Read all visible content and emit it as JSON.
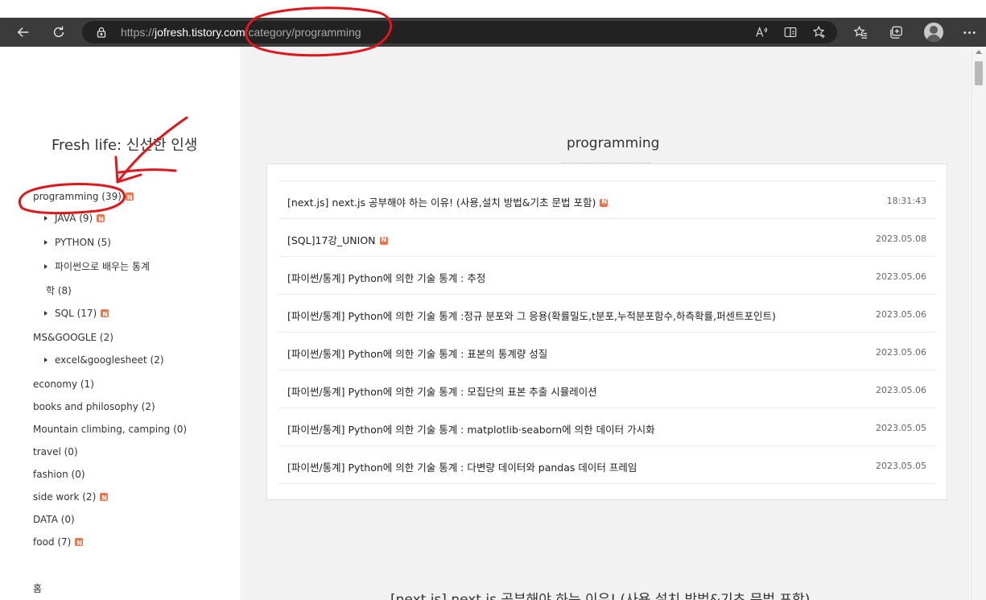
{
  "browser": {
    "url_scheme": "https://",
    "url_host": "jofresh.tistory.com",
    "url_path": "/category/programming"
  },
  "sidebar": {
    "blog_title": "Fresh life: 신선한 인생",
    "categories": [
      {
        "label": "programming (39)",
        "new": true
      },
      {
        "label": "JAVA (9)",
        "new": true
      },
      {
        "label": "PYTHON (5)",
        "new": false
      },
      {
        "label": "파이썬으로 배우는 통계",
        "new": false
      },
      {
        "label": "학 (8)",
        "new": false
      },
      {
        "label": "SQL (17)",
        "new": true
      },
      {
        "label": "MS&GOOGLE (2)",
        "new": false
      },
      {
        "label": "excel&googlesheet (2)",
        "new": false
      },
      {
        "label": "economy (1)",
        "new": false
      },
      {
        "label": "books and philosophy (2)",
        "new": false
      },
      {
        "label": "Mountain climbing, camping (0)",
        "new": false
      },
      {
        "label": "travel (0)",
        "new": false
      },
      {
        "label": "fashion (0)",
        "new": false
      },
      {
        "label": "side work (2)",
        "new": true
      },
      {
        "label": "DATA (0)",
        "new": false
      },
      {
        "label": "food (7)",
        "new": true
      }
    ],
    "home_link": "홈"
  },
  "main": {
    "heading": "programming",
    "posts": [
      {
        "title": "[next.js] next.js 공부해야 하는 이유! (사용,설치 방법&기초 문법 포함)",
        "date": "18:31:43",
        "new": true
      },
      {
        "title": "[SQL]17강_UNION",
        "date": "2023.05.08",
        "new": true
      },
      {
        "title": "[파이썬/통계] Python에 의한 기술 통계 : 추정",
        "date": "2023.05.06",
        "new": false
      },
      {
        "title": "[파이썬/통계] Python에 의한 기술 통계 :정규 분포와 그 응용(확률밀도,t분포,누적분포함수,하측확률,퍼센트포인트)",
        "date": "2023.05.06",
        "new": false
      },
      {
        "title": "[파이썬/통계] Python에 의한 기술 통계 : 표본의 통계량 성질",
        "date": "2023.05.06",
        "new": false
      },
      {
        "title": "[파이썬/통계] Python에 의한 기술 통계 : 모집단의 표본 추출 시뮬레이션",
        "date": "2023.05.06",
        "new": false
      },
      {
        "title": "[파이썬/통계] Python에 의한 기술 통계 : matplotlib·seaborn에 의한 데이터 가시화",
        "date": "2023.05.05",
        "new": false
      },
      {
        "title": "[파이썬/통계] Python에 의한 기술 통계 : 다변량 데이터와 pandas 데이터 프레임",
        "date": "2023.05.05",
        "new": false
      }
    ],
    "bottom_title": "[next.js] next.js 공부해야 하는 이유! (사용,설치 방법&기초 문법 포함)"
  },
  "colors": {
    "chrome": "#3b3b3b",
    "url_field": "#222222",
    "main_bg": "#f2f2f2",
    "new_badge": "#f0744a",
    "annotation": "#e0161a"
  }
}
